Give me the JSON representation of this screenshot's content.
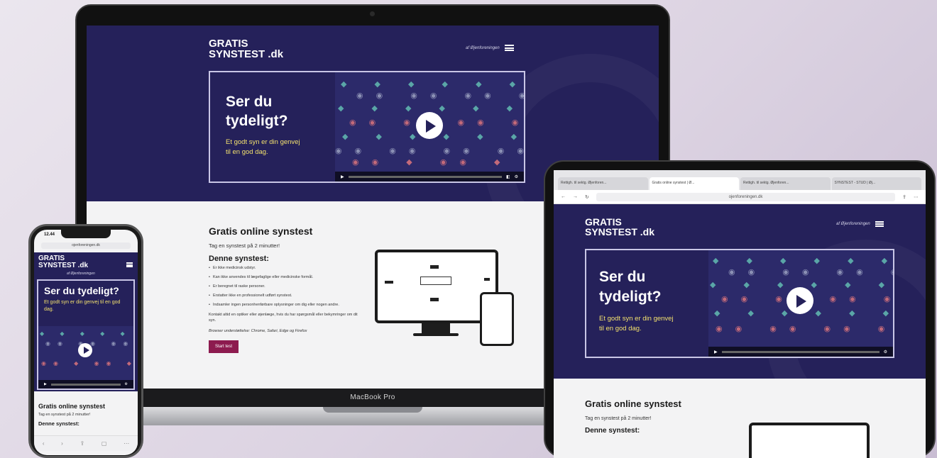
{
  "brand": {
    "logo_line1": "GRATIS",
    "logo_line2": "SYNSTEST",
    "logo_suffix": ".dk",
    "byline": "af Øjenforeningen"
  },
  "hero": {
    "title_line1": "Ser du",
    "title_line2": "tydeligt?",
    "title_single": "Ser du tydeligt?",
    "subtitle_line1": "Et godt syn er din genvej",
    "subtitle_line2": "til en god dag.",
    "subtitle_single": "Et godt syn er din genvej til en god dag."
  },
  "content": {
    "heading": "Gratis online synstest",
    "tagline": "Tag en synstest på 2 minutter!",
    "subheading": "Denne synstest:",
    "bullets": [
      "Er ikke medicinsk udstyr.",
      "Kan ikke anvendes til lægefaglige eller medicinske formål.",
      "Er beregnet til raske personer.",
      "Erstatter ikke en professionelt udført synstest.",
      "Indsamler ingen personhenførbare oplysninger om dig eller nogen andre."
    ],
    "contact": "Kontakt altid en optiker eller øjenlæge, hvis du har spørgsmål eller bekymringer om dit syn.",
    "browsers": "Browser understøttelse: Chrome, Safari, Edge og Firefox",
    "start_button": "Start test"
  },
  "devices": {
    "macbook_label": "MacBook Pro"
  },
  "ipad": {
    "tabs": [
      "Rettigh. til sektg. Øjenforen...",
      "Gratis online synstest | Ø...",
      "Rettigh. til sektg. Øjenforen...",
      "SYNSTEST - STUD | Øj..."
    ],
    "url": "ojenforeningen.dk"
  },
  "iphone": {
    "time": "12.44",
    "url": "ojenforeningen.dk"
  },
  "colors": {
    "hero_bg": "#25215a",
    "accent_yellow": "#f2e06e",
    "button": "#8d1b4f"
  }
}
